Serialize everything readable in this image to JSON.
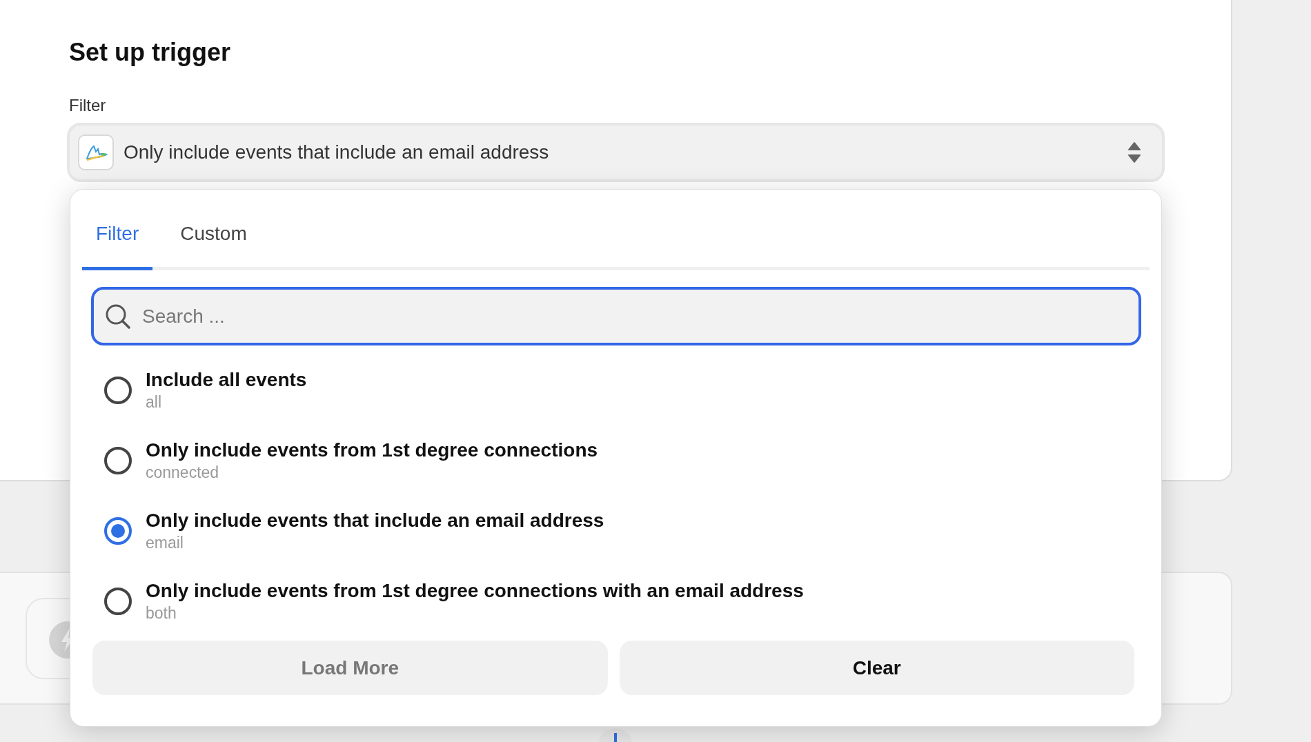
{
  "title": "Set up trigger",
  "filter": {
    "label": "Filter",
    "value": "Only include events that include an email address"
  },
  "dropdown": {
    "tabs": [
      {
        "label": "Filter",
        "selected": true
      },
      {
        "label": "Custom",
        "selected": false
      }
    ],
    "search": {
      "placeholder": "Search ..."
    },
    "options": [
      {
        "label": "Include all events",
        "value": "all",
        "selected": false
      },
      {
        "label": "Only include events from 1st degree connections",
        "value": "connected",
        "selected": false
      },
      {
        "label": "Only include events that include an email address",
        "value": "email",
        "selected": true
      },
      {
        "label": "Only include events from 1st degree connections with an email address",
        "value": "both",
        "selected": false
      }
    ],
    "buttons": [
      {
        "label": "Load More",
        "disabled": true
      },
      {
        "label": "Clear",
        "disabled": false
      }
    ]
  }
}
